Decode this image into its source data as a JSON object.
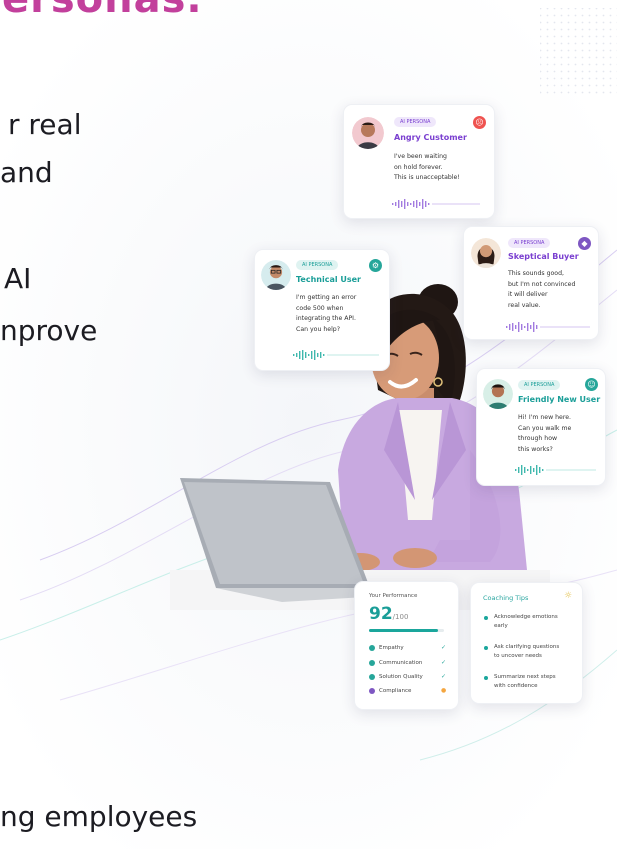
{
  "hero": {
    "title": "ersonas.",
    "lines": [
      "r real",
      "and",
      "AI",
      "nprove",
      "ng employees"
    ]
  },
  "personas": [
    {
      "tag": "AI PERSONA",
      "name": "Angry Customer",
      "message": [
        "I've been waiting",
        "on hold forever.",
        "This is unacceptable!"
      ],
      "status_icon": "angry-face-icon",
      "accent": "#7a3fd0",
      "status_color": "#ef5350"
    },
    {
      "tag": "AI PERSONA",
      "name": "Skeptical Buyer",
      "message": [
        "This sounds good,",
        "but I'm not convinced",
        "it will deliver",
        "real value."
      ],
      "status_icon": "shield-icon",
      "accent": "#7a3fd0",
      "status_color": "#7e57c2"
    },
    {
      "tag": "AI PERSONA",
      "name": "Technical User",
      "message": [
        "I'm getting an error",
        "code 500 when",
        "integrating the API.",
        "Can you help?"
      ],
      "status_icon": "gear-icon",
      "accent": "#1a9e98",
      "status_color": "#26a69a"
    },
    {
      "tag": "AI PERSONA",
      "name": "Friendly New User",
      "message": [
        "Hi! I'm new here.",
        "Can you walk me",
        "through how",
        "this works?"
      ],
      "status_icon": "smile-icon",
      "accent": "#1a9e98",
      "status_color": "#26a69a"
    }
  ],
  "performance": {
    "title": "Your Performance",
    "score": "92",
    "out_of": "/100",
    "progress": 0.92,
    "metrics": [
      {
        "label": "Empathy",
        "dot_color": "#26a69a",
        "status": "check",
        "status_color": "#26a69a"
      },
      {
        "label": "Communication",
        "dot_color": "#26a69a",
        "status": "check",
        "status_color": "#26a69a"
      },
      {
        "label": "Solution Quality",
        "dot_color": "#26a69a",
        "status": "check",
        "status_color": "#26a69a"
      },
      {
        "label": "Compliance",
        "dot_color": "#7e57c2",
        "status": "warning",
        "status_color": "#f4a640"
      }
    ]
  },
  "coaching": {
    "title": "Coaching Tips",
    "icon": "lightbulb-icon",
    "tips": [
      [
        "Acknowledge emotions",
        "early"
      ],
      [
        "Ask clarifying questions",
        "to uncover needs"
      ],
      [
        "Summarize next steps",
        "with confidence"
      ]
    ]
  }
}
